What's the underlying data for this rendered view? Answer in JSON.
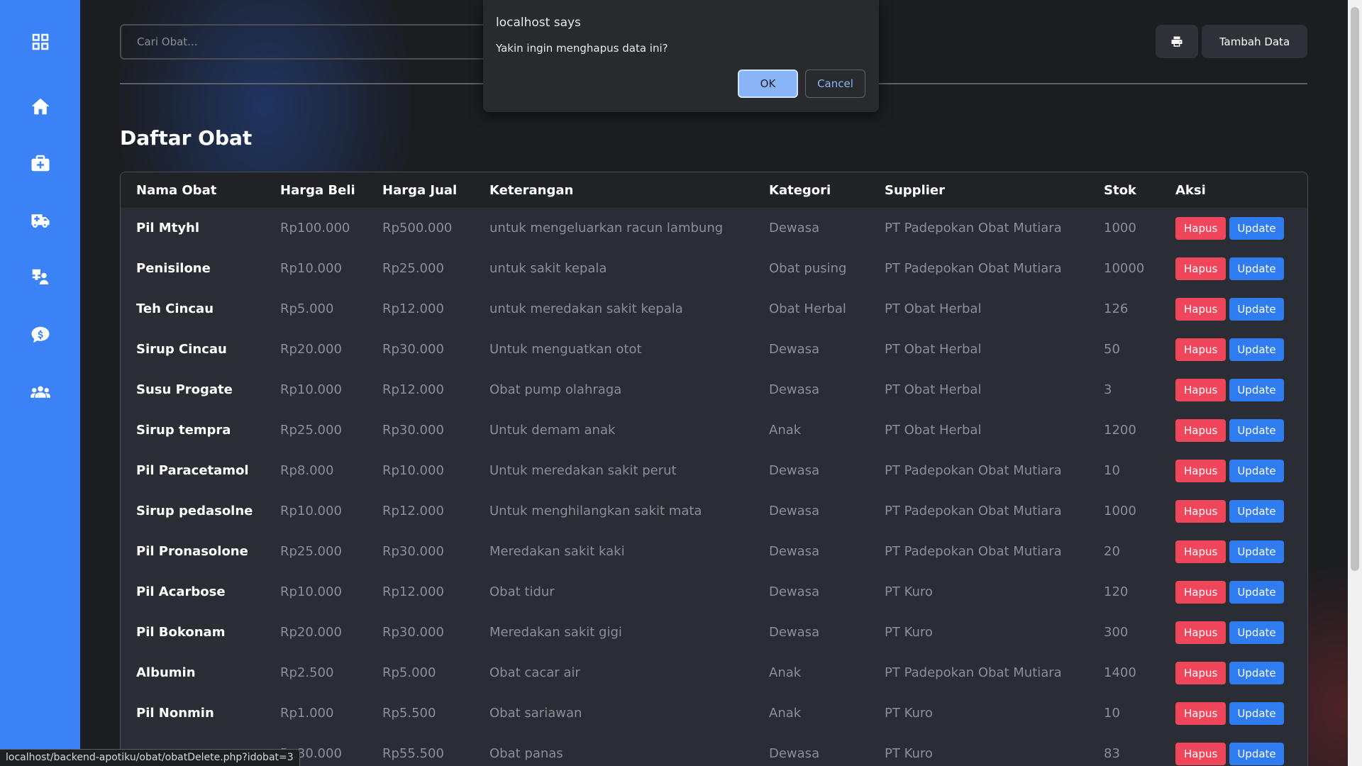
{
  "search": {
    "placeholder": "Cari Obat..."
  },
  "toolbar": {
    "print_icon": "print-icon",
    "add_label": "Tambah Data"
  },
  "page": {
    "title": "Daftar Obat"
  },
  "sidebar": {
    "items": [
      {
        "icon": "grid-icon"
      },
      {
        "icon": "home-icon"
      },
      {
        "icon": "medkit-icon"
      },
      {
        "icon": "ambulance-icon"
      },
      {
        "icon": "user-medical-icon"
      },
      {
        "icon": "chat-dollar-icon"
      },
      {
        "icon": "users-icon"
      }
    ]
  },
  "table": {
    "headers": [
      "Nama Obat",
      "Harga Beli",
      "Harga Jual",
      "Keterangan",
      "Kategori",
      "Supplier",
      "Stok",
      "Aksi"
    ],
    "action_delete": "Hapus",
    "action_update": "Update",
    "rows": [
      {
        "nama": "Pil Mtyhl",
        "beli": "Rp100.000",
        "jual": "Rp500.000",
        "ket": "untuk mengeluarkan racun lambung",
        "kategori": "Dewasa",
        "supplier": "PT Padepokan Obat Mutiara",
        "stok": "1000"
      },
      {
        "nama": "Penisilone",
        "beli": "Rp10.000",
        "jual": "Rp25.000",
        "ket": "untuk sakit kepala",
        "kategori": "Obat pusing",
        "supplier": "PT Padepokan Obat Mutiara",
        "stok": "10000"
      },
      {
        "nama": "Teh Cincau",
        "beli": "Rp5.000",
        "jual": "Rp12.000",
        "ket": "untuk meredakan sakit kepala",
        "kategori": "Obat Herbal",
        "supplier": "PT Obat Herbal",
        "stok": "126"
      },
      {
        "nama": "Sirup Cincau",
        "beli": "Rp20.000",
        "jual": "Rp30.000",
        "ket": "Untuk menguatkan otot",
        "kategori": "Dewasa",
        "supplier": "PT Obat Herbal",
        "stok": "50"
      },
      {
        "nama": "Susu Progate",
        "beli": "Rp10.000",
        "jual": "Rp12.000",
        "ket": "Obat pump olahraga",
        "kategori": "Dewasa",
        "supplier": "PT Obat Herbal",
        "stok": "3"
      },
      {
        "nama": "Sirup tempra",
        "beli": "Rp25.000",
        "jual": "Rp30.000",
        "ket": "Untuk demam anak",
        "kategori": "Anak",
        "supplier": "PT Obat Herbal",
        "stok": "1200"
      },
      {
        "nama": "Pil Paracetamol",
        "beli": "Rp8.000",
        "jual": "Rp10.000",
        "ket": "Untuk meredakan sakit perut",
        "kategori": "Dewasa",
        "supplier": "PT Padepokan Obat Mutiara",
        "stok": "10"
      },
      {
        "nama": "Sirup pedasolne",
        "beli": "Rp10.000",
        "jual": "Rp12.000",
        "ket": "Untuk menghilangkan sakit mata",
        "kategori": "Dewasa",
        "supplier": "PT Padepokan Obat Mutiara",
        "stok": "1000"
      },
      {
        "nama": "Pil Pronasolone",
        "beli": "Rp25.000",
        "jual": "Rp30.000",
        "ket": "Meredakan sakit kaki",
        "kategori": "Dewasa",
        "supplier": "PT Padepokan Obat Mutiara",
        "stok": "20"
      },
      {
        "nama": "Pil Acarbose",
        "beli": "Rp10.000",
        "jual": "Rp12.000",
        "ket": "Obat tidur",
        "kategori": "Dewasa",
        "supplier": "PT Kuro",
        "stok": "120"
      },
      {
        "nama": "Pil Bokonam",
        "beli": "Rp20.000",
        "jual": "Rp30.000",
        "ket": "Meredakan sakit gigi",
        "kategori": "Dewasa",
        "supplier": "PT Kuro",
        "stok": "300"
      },
      {
        "nama": "Albumin",
        "beli": "Rp2.500",
        "jual": "Rp5.000",
        "ket": "Obat cacar air",
        "kategori": "Anak",
        "supplier": "PT Padepokan Obat Mutiara",
        "stok": "1400"
      },
      {
        "nama": "Pil Nonmin",
        "beli": "Rp1.000",
        "jual": "Rp5.500",
        "ket": "Obat sariawan",
        "kategori": "Anak",
        "supplier": "PT Kuro",
        "stok": "10"
      },
      {
        "nama": "",
        "beli": "Rp30.000",
        "jual": "Rp55.500",
        "ket": "Obat panas",
        "kategori": "Dewasa",
        "supplier": "PT Kuro",
        "stok": "83"
      }
    ]
  },
  "dialog": {
    "title": "localhost says",
    "message": "Yakin ingin menghapus data ini?",
    "ok_label": "OK",
    "cancel_label": "Cancel"
  },
  "status_url": "localhost/backend-apotiku/obat/obatDelete.php?idobat=3"
}
